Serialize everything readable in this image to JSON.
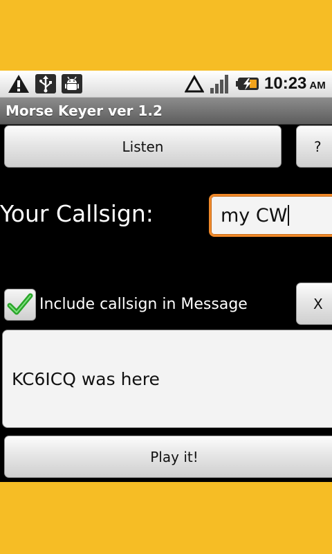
{
  "status_bar": {
    "left_icons": [
      "warning-icon",
      "usb-icon",
      "android-debug-icon"
    ],
    "right_icons": [
      "signal-triangle-icon",
      "signal-bars-icon",
      "battery-charging-icon"
    ],
    "time": "10:23",
    "ampm": "AM"
  },
  "app": {
    "title": "Morse Keyer ver 1.2"
  },
  "buttons": {
    "listen": "Listen",
    "help": "?",
    "clear": "X",
    "play": "Play it!"
  },
  "callsign": {
    "label": "Your Callsign:",
    "value": "my CW"
  },
  "include_callsign": {
    "label": "Include callsign in Message",
    "checked": true
  },
  "message": {
    "value": "KC6ICQ was here"
  },
  "colors": {
    "background_outer": "#f6bd25",
    "focus_border": "#f0892a",
    "check_green": "#2aa52a"
  }
}
